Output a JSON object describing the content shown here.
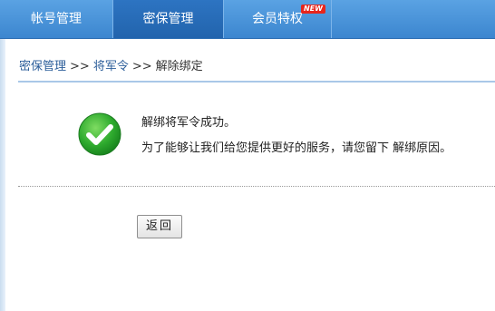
{
  "nav": {
    "tabs": [
      {
        "label": "帐号管理"
      },
      {
        "label": "密保管理",
        "active": true
      },
      {
        "label": "会员特权",
        "badge": "NEW"
      }
    ]
  },
  "breadcrumb": {
    "items": [
      "密保管理",
      "将军令",
      "解除绑定"
    ],
    "separator": ">>"
  },
  "result": {
    "icon": "check-circle-icon",
    "title": "解绑将军令成功。",
    "message": "为了能够让我们给您提供更好的服务，请您留下 解绑原因。"
  },
  "actions": {
    "back_label": "返回"
  },
  "colors": {
    "nav_bg": "#3c86cf",
    "nav_active": "#2264ad",
    "link": "#2c5e9a",
    "success_green": "#2aa62a",
    "badge_red": "#e8251c"
  }
}
